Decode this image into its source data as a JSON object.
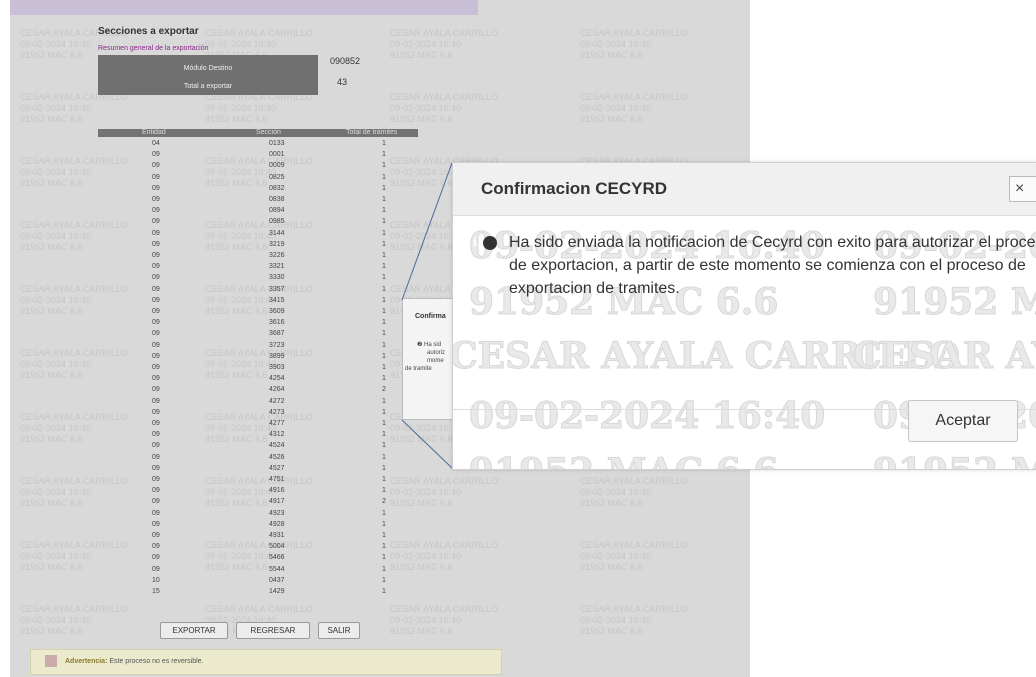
{
  "page": {
    "section_title": "Secciones a exportar",
    "summary_link": "Resumen general de la exportación",
    "module_label": "Módulo Destino",
    "module_value": "090852",
    "total_label": "Total a exportar",
    "total_value": "43",
    "table": {
      "headers": [
        "Entidad",
        "Sección",
        "Total de trámites"
      ],
      "rows": [
        [
          "04",
          "0133",
          "1"
        ],
        [
          "09",
          "0001",
          "1"
        ],
        [
          "09",
          "0009",
          "1"
        ],
        [
          "09",
          "0825",
          "1"
        ],
        [
          "09",
          "0832",
          "1"
        ],
        [
          "09",
          "0838",
          "1"
        ],
        [
          "09",
          "0894",
          "1"
        ],
        [
          "09",
          "0985",
          "1"
        ],
        [
          "09",
          "3144",
          "1"
        ],
        [
          "09",
          "3219",
          "1"
        ],
        [
          "09",
          "3226",
          "1"
        ],
        [
          "09",
          "3321",
          "1"
        ],
        [
          "09",
          "3330",
          "1"
        ],
        [
          "09",
          "3357",
          "1"
        ],
        [
          "09",
          "3415",
          "1"
        ],
        [
          "09",
          "3609",
          "1"
        ],
        [
          "09",
          "3616",
          "1"
        ],
        [
          "09",
          "3687",
          "1"
        ],
        [
          "09",
          "3723",
          "1"
        ],
        [
          "09",
          "3899",
          "1"
        ],
        [
          "09",
          "3903",
          "1"
        ],
        [
          "09",
          "4254",
          "1"
        ],
        [
          "09",
          "4264",
          "2"
        ],
        [
          "09",
          "4272",
          "1"
        ],
        [
          "09",
          "4273",
          "1"
        ],
        [
          "09",
          "4277",
          "1"
        ],
        [
          "09",
          "4312",
          "1"
        ],
        [
          "09",
          "4524",
          "1"
        ],
        [
          "09",
          "4526",
          "1"
        ],
        [
          "09",
          "4527",
          "1"
        ],
        [
          "09",
          "4751",
          "1"
        ],
        [
          "09",
          "4916",
          "1"
        ],
        [
          "09",
          "4917",
          "2"
        ],
        [
          "09",
          "4923",
          "1"
        ],
        [
          "09",
          "4928",
          "1"
        ],
        [
          "09",
          "4931",
          "1"
        ],
        [
          "09",
          "5004",
          "1"
        ],
        [
          "09",
          "5466",
          "1"
        ],
        [
          "09",
          "5544",
          "1"
        ],
        [
          "10",
          "0437",
          "1"
        ],
        [
          "15",
          "1429",
          "1"
        ]
      ]
    },
    "buttons": {
      "export": "EXPORTAR",
      "back": "REGRESAR",
      "exit": "SALIR"
    },
    "warning": {
      "label": "Advertencia:",
      "text": "Este proceso no es reversible."
    },
    "mini_dialog": {
      "title": "Confirma",
      "lines": [
        "Ha sid",
        "autoriz",
        "mome",
        "de tramite"
      ]
    }
  },
  "watermark": {
    "name": "CESAR AYALA CARRILLO",
    "datetime": "09-02-2024 16:40",
    "module": "91952 MAC 6.6"
  },
  "dialog": {
    "title": "Confirmacion CECYRD",
    "close_icon": "×",
    "info_icon": "i",
    "message": "Ha sido enviada la notificacion de Cecyrd con exito para autorizar el proceso de exportacion, a partir de este momento se comienza con el proceso de exportacion de tramites.",
    "accept_label": "Aceptar"
  }
}
